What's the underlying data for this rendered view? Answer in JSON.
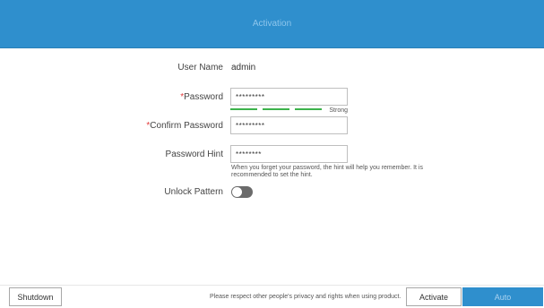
{
  "header": {
    "title": "Activation"
  },
  "form": {
    "user_name": {
      "label": "User Name",
      "value": "admin"
    },
    "password": {
      "required_mark": "*",
      "label": "Password",
      "value": "*********"
    },
    "strength": {
      "label": "Strong",
      "segments": 3
    },
    "confirm_password": {
      "required_mark": "*",
      "label": "Confirm Password",
      "value": "*********"
    },
    "password_hint": {
      "label": "Password Hint",
      "value": "********",
      "note": "When you forget your password, the hint will help you remember. It is recommended to set the hint."
    },
    "unlock_pattern": {
      "label": "Unlock Pattern",
      "enabled": false
    }
  },
  "footer": {
    "shutdown_label": "Shutdown",
    "privacy_text": "Please respect other people's privacy and rights when using product.",
    "activate_label": "Activate",
    "auto_label": "Auto"
  },
  "colors": {
    "accent": "#2f8fcd",
    "required": "#e23c3c",
    "strength": "#3cb24b",
    "toggle_off": "#6b6b6b"
  }
}
